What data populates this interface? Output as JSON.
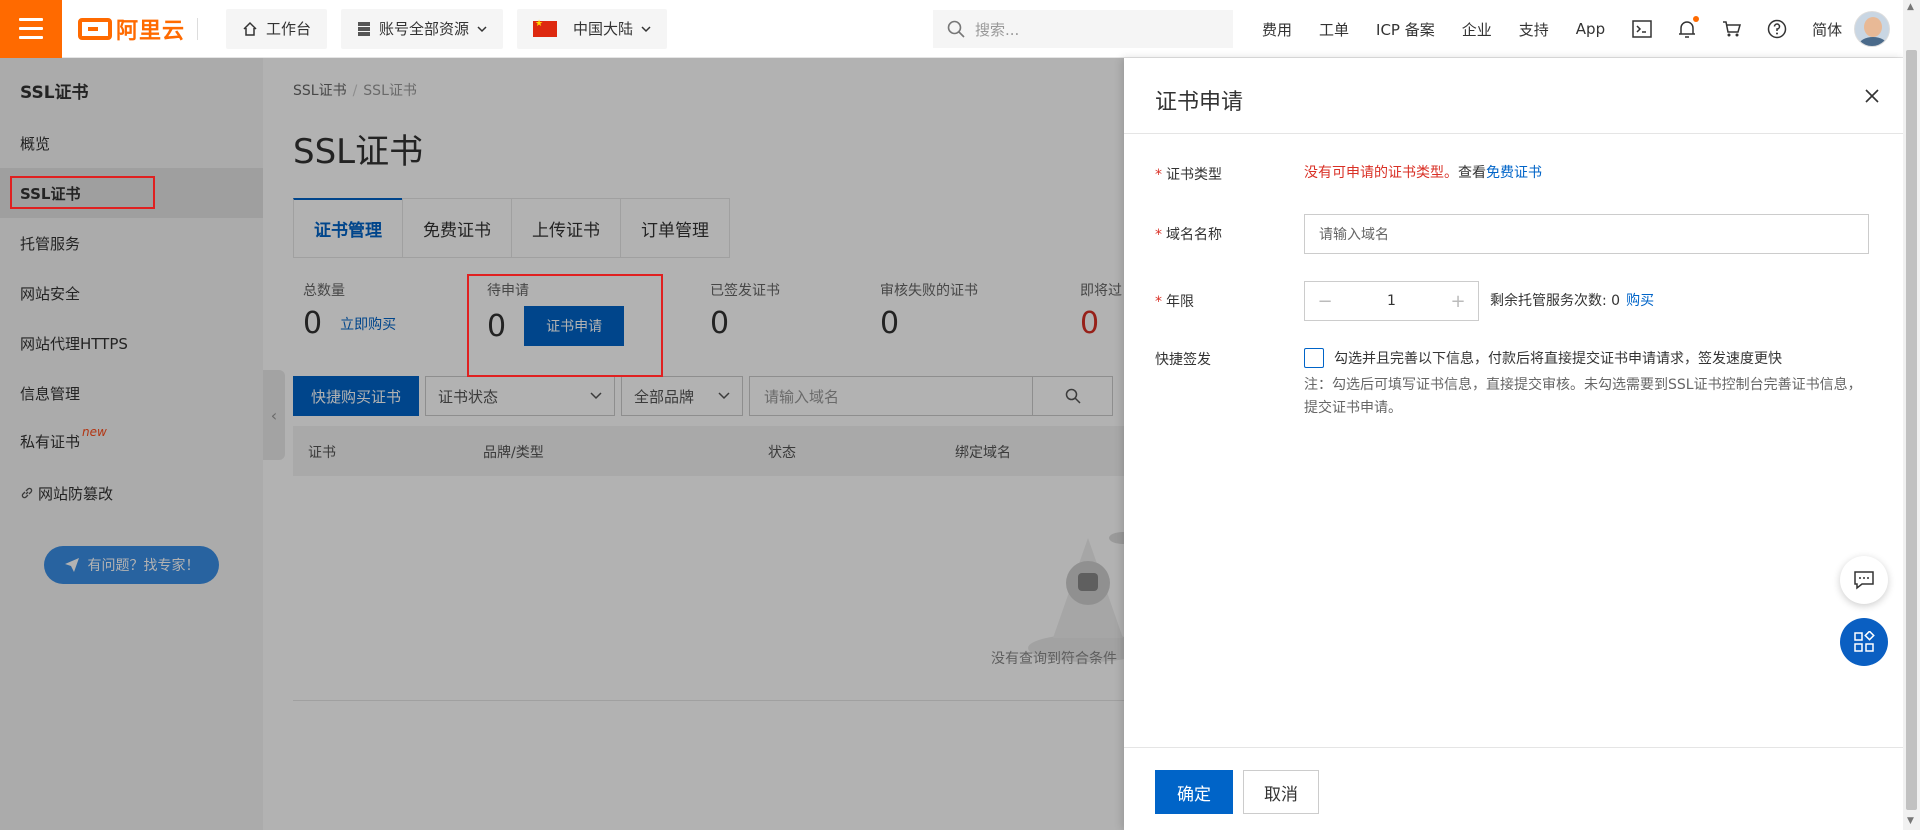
{
  "topbar": {
    "brand": "阿里云",
    "workbench": "工作台",
    "resources": "账号全部资源",
    "region": "中国大陆",
    "search_placeholder": "搜索...",
    "links": [
      "费用",
      "工单",
      "ICP 备案",
      "企业",
      "支持",
      "App"
    ],
    "language": "简体"
  },
  "sidebar": {
    "title": "SSL证书",
    "items": [
      {
        "label": "概览"
      },
      {
        "label": "SSL证书"
      },
      {
        "label": "托管服务"
      },
      {
        "label": "网站安全"
      },
      {
        "label": "网站代理HTTPS"
      },
      {
        "label": "信息管理"
      },
      {
        "label": "私有证书",
        "badge": "new"
      },
      {
        "label": "网站防篡改"
      }
    ],
    "help_button": "有问题？找专家！"
  },
  "main": {
    "breadcrumb": [
      "SSL证书",
      "SSL证书"
    ],
    "title": "SSL证书",
    "tabs": [
      "证书管理",
      "免费证书",
      "上传证书",
      "订单管理"
    ],
    "stats": [
      {
        "label": "总数量",
        "value": "0",
        "link": "立即购买"
      },
      {
        "label": "待申请",
        "value": "0",
        "button": "证书申请"
      },
      {
        "label": "已签发证书",
        "value": "0"
      },
      {
        "label": "审核失败的证书",
        "value": "0"
      },
      {
        "label": "即将过",
        "value": "0"
      }
    ],
    "toolbar": {
      "buy_button": "快捷购买证书",
      "status_select": "证书状态",
      "brand_select": "全部品牌",
      "domain_placeholder": "请输入域名"
    },
    "columns": [
      "证书",
      "品牌/类型",
      "状态",
      "绑定域名"
    ],
    "empty_text": "没有查询到符合条件"
  },
  "drawer": {
    "title": "证书申请",
    "cert_type_label": "证书类型",
    "cert_type_warning": "没有可申请的证书类型。",
    "cert_type_view": "查看",
    "cert_type_link": "免费证书",
    "domain_label": "域名名称",
    "domain_placeholder": "请输入域名",
    "years_label": "年限",
    "years_value": "1",
    "remaining_label": "剩余托管服务次数:",
    "remaining_value": "0",
    "buy_link": "购买",
    "quick_label": "快捷签发",
    "quick_checkbox": "勾选并且完善以下信息，付款后将直接提交证书申请请求，签发速度更快",
    "note": "注：勾选后可填写证书信息，直接提交审核。未勾选需要到SSL证书控制台完善证书信息，提交证书申请。",
    "ok_button": "确定",
    "cancel_button": "取消"
  },
  "colors": {
    "brand_orange": "#ff6a00",
    "primary_blue": "#0064c8",
    "error_red": "#d93026",
    "highlight_red": "#e02020"
  }
}
